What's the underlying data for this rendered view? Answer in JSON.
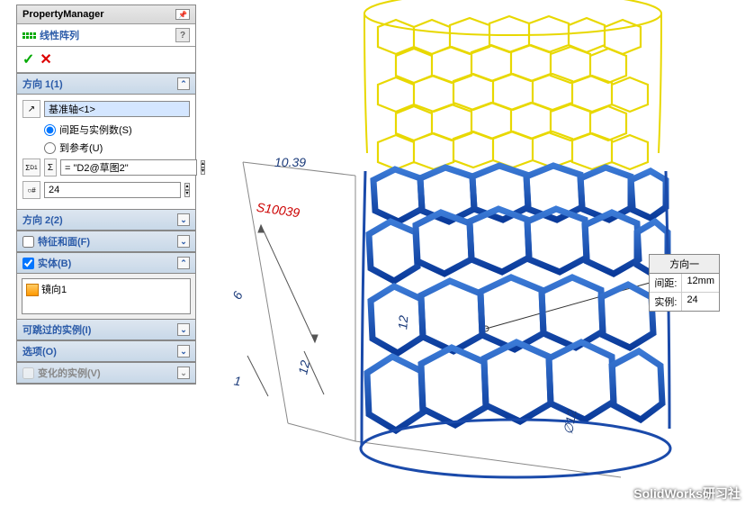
{
  "panel": {
    "header_title": "PropertyManager",
    "feature_title": "线性阵列",
    "sections": {
      "dir1": {
        "title": "方向 1(1)",
        "ref_value": "基准轴<1>",
        "radio1": "间距与实例数(S)",
        "radio2": "到参考(U)",
        "spacing_value": "= \"D2@草图2\"",
        "count_value": "24"
      },
      "dir2": {
        "title": "方向 2(2)"
      },
      "features": {
        "title": "特征和面(F)"
      },
      "bodies": {
        "title": "实体(B)",
        "item": "镜向1"
      },
      "skip": {
        "title": "可跳过的实例(I)"
      },
      "options": {
        "title": "选项(O)"
      },
      "varied": {
        "title": "变化的实例(V)"
      }
    }
  },
  "viewport": {
    "dim_width": "10.39",
    "dim_s": "S10039",
    "dim_6": "6",
    "dim_1": "1",
    "dim_12a": "12",
    "dim_12b": "12",
    "dim_phi12": "∅12",
    "callout": {
      "title": "方向一",
      "rows": [
        {
          "label": "间距:",
          "value": "12mm"
        },
        {
          "label": "实例:",
          "value": "24"
        }
      ]
    }
  },
  "watermark": "SolidWorks研习社"
}
